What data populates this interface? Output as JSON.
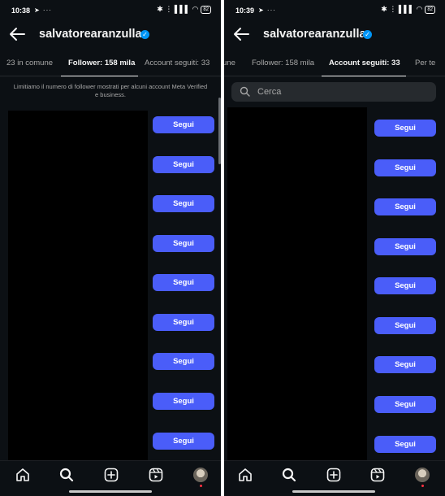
{
  "left": {
    "status": {
      "time": "10:38",
      "icons": "➤ ···",
      "right_icons": "✱ ⋮ ▌▌▌ ◠",
      "battery": "82"
    },
    "header": {
      "title": "salvatorearanzulla",
      "back_icon": "back-arrow-icon",
      "verified_icon": "verified-badge-icon"
    },
    "tabs": [
      "23 in comune",
      "Follower: 158 mila",
      "Account seguiti: 33"
    ],
    "active_tab": 1,
    "notice": "Limitiamo il numero di follower mostrati per alcuni account Meta Verified e business.",
    "follow_label": "Segui",
    "buttons_count_visible": 9
  },
  "right": {
    "status": {
      "time": "10:39",
      "icons": "➤ ···",
      "right_icons": "✱ ⋮ ▌▌▌ ◠",
      "battery": "82"
    },
    "header": {
      "title": "salvatorearanzulla",
      "back_icon": "back-arrow-icon",
      "verified_icon": "verified-badge-icon"
    },
    "tabs": [
      "une",
      "Follower: 158 mila",
      "Account seguiti: 33",
      "Per te"
    ],
    "active_tab": 2,
    "search": {
      "placeholder": "Cerca",
      "icon": "search-icon"
    },
    "follow_label": "Segui",
    "buttons_count_visible": 9
  },
  "bottom_nav": [
    "home-icon",
    "search-icon",
    "create-icon",
    "reels-icon",
    "profile-avatar"
  ],
  "colors": {
    "background": "#0c1014",
    "button": "#4a5df9",
    "verified": "#0095f6",
    "text_secondary": "#a8a8a8"
  }
}
